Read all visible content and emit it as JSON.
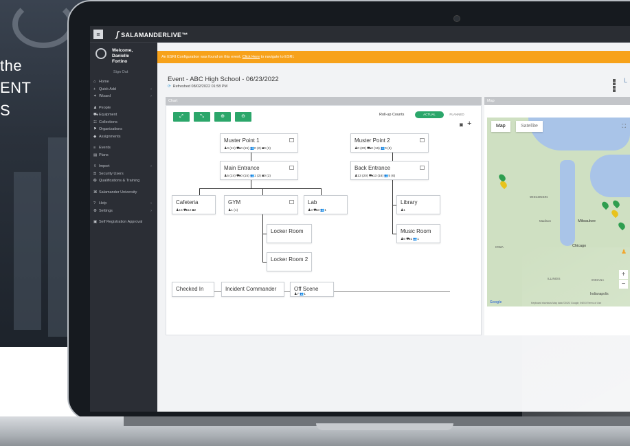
{
  "promo": {
    "line1": "the",
    "line2": "ENT",
    "line3": "S"
  },
  "app": {
    "menu_icon": "hamburger-icon",
    "logo_text": "SALAMANDERLIVE",
    "logo_tm": "™"
  },
  "sidebar": {
    "welcome": "Welcome,",
    "first_name": "Danielle",
    "last_name": "Fortino",
    "sign_out": "Sign Out",
    "groups": [
      [
        {
          "icon": "home-icon",
          "label": "Home",
          "chevron": false
        },
        {
          "icon": "plus-icon",
          "label": "Quick Add",
          "chevron": true
        },
        {
          "icon": "wand-icon",
          "label": "Wizard",
          "chevron": true
        }
      ],
      [
        {
          "icon": "person-icon",
          "label": "People",
          "chevron": false
        },
        {
          "icon": "truck-icon",
          "label": "Equipment",
          "chevron": false
        },
        {
          "icon": "group-icon",
          "label": "Collections",
          "chevron": false
        },
        {
          "icon": "flag-icon",
          "label": "Organizations",
          "chevron": false
        },
        {
          "icon": "tag-icon",
          "label": "Assignments",
          "chevron": false
        }
      ],
      [
        {
          "icon": "list-icon",
          "label": "Events",
          "chevron": false
        },
        {
          "icon": "clipboard-icon",
          "label": "Plans",
          "chevron": false
        }
      ],
      [
        {
          "icon": "import-icon",
          "label": "Import",
          "chevron": true
        },
        {
          "icon": "lock-icon",
          "label": "Security Users",
          "chevron": false
        },
        {
          "icon": "badge-icon",
          "label": "Qualifications & Training",
          "chevron": false
        }
      ],
      [
        {
          "icon": "university-icon",
          "label": "Salamander University",
          "chevron": false
        }
      ],
      [
        {
          "icon": "question-icon",
          "label": "Help",
          "chevron": true
        },
        {
          "icon": "gear-icon",
          "label": "Settings",
          "chevron": true
        }
      ],
      [
        {
          "icon": "register-icon",
          "label": "Self Registration Approval",
          "chevron": false
        }
      ]
    ]
  },
  "banner": {
    "text_before": "An ESRI Configuration was found on this event.",
    "link": "Click Here",
    "text_after": "to navigate to ESRI."
  },
  "event": {
    "title": "Event - ABC High School - 06/23/2022",
    "refreshed": "Refreshed 08/02/2022 01:58 PM",
    "refresh_icon": "refresh-icon",
    "view_icons": [
      "grid-icon",
      "list-icon"
    ],
    "view_text": "L"
  },
  "chart": {
    "header": "Chart",
    "toolbar": [
      {
        "name": "expand-button",
        "glyph": "⤢"
      },
      {
        "name": "collapse-button",
        "glyph": "⤡"
      },
      {
        "name": "zoom-in-button",
        "glyph": "⊕"
      },
      {
        "name": "zoom-out-button",
        "glyph": "⊖"
      }
    ],
    "rollup_label": "Roll-up Counts",
    "toggle_actual": "ACTUAL",
    "toggle_planned": "PLANNED",
    "camera_icon": "camera-icon",
    "add_icon": "plus-icon",
    "nodes": {
      "mp1": {
        "name": "Muster Point 1",
        "stats": "♟0 (24)  ⛟0 (15)  👥0 (2)  ◙0 (2)"
      },
      "mp2": {
        "name": "Muster Point 2",
        "stats": "♟0 (20)  ⛟0 (16)  👥0 (6)"
      },
      "me": {
        "name": "Main Entrance",
        "stats": "♟5 (24)  ⛟0 (15)  👥1 (2)  ◙0 (2)"
      },
      "be": {
        "name": "Back Entrance",
        "stats": "♟13 (20)  ⛟13 (16)  👥5 (6)"
      },
      "caf": {
        "name": "Cafeteria",
        "stats": "♟15  ⛟12  ◙2"
      },
      "gym": {
        "name": "GYM",
        "stats": "♟1 (1)"
      },
      "lab": {
        "name": "Lab",
        "stats": "♟3  ⛟3  👥1"
      },
      "lib": {
        "name": "Library",
        "stats": "♟1"
      },
      "lr1": {
        "name": "Locker Room",
        "stats": ""
      },
      "mr": {
        "name": "Music Room",
        "stats": "♟6  ⛟1  👥1"
      },
      "lr2": {
        "name": "Locker Room 2",
        "stats": ""
      },
      "ci": {
        "name": "Checked In",
        "stats": ""
      },
      "ic": {
        "name": "Incident Commander",
        "stats": ""
      },
      "os": {
        "name": "Off Scene",
        "stats": "♟7   👥1"
      }
    }
  },
  "map": {
    "header": "Map",
    "tab_map": "Map",
    "tab_satellite": "Satellite",
    "fullscreen_icon": "fullscreen-icon",
    "pegman_icon": "pegman-icon",
    "labels": {
      "wisconsin": "WISCONSIN",
      "milwaukee": "Milwaukee",
      "chicago": "Chicago",
      "iowa": "IOWA",
      "illinois": "ILLINOIS",
      "indiana": "INDIANA",
      "indianapolis": "Indianapolis",
      "madison": "Madison",
      "google": "Google",
      "attribution": "Keyboard shortcuts  Map data ©2022 Google, INEGI  Terms of Use"
    },
    "zoom_in": "+",
    "zoom_out": "−",
    "pin_colors": [
      "#2e9e4f",
      "#e8c31c"
    ]
  }
}
